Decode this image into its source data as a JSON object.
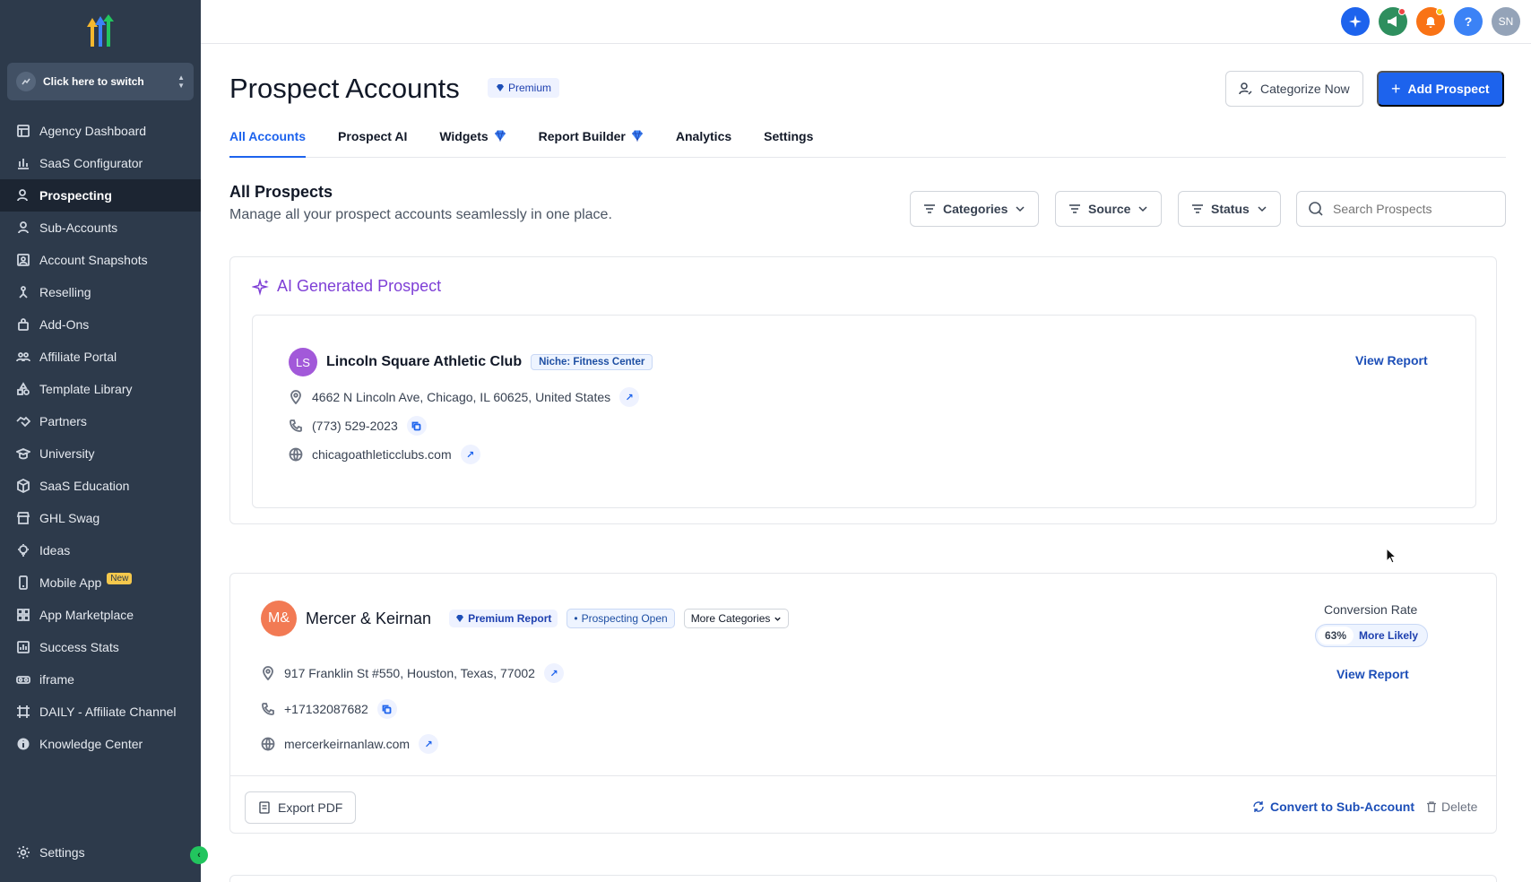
{
  "sidebar": {
    "switcher_label": "Click here to switch",
    "items": [
      {
        "label": "Agency Dashboard",
        "icon": "dashboard-icon"
      },
      {
        "label": "SaaS Configurator",
        "icon": "chart-bars-icon"
      },
      {
        "label": "Prospecting",
        "icon": "user-search-icon",
        "active": true
      },
      {
        "label": "Sub-Accounts",
        "icon": "user-icon"
      },
      {
        "label": "Account Snapshots",
        "icon": "snapshot-icon"
      },
      {
        "label": "Reselling",
        "icon": "reselling-icon"
      },
      {
        "label": "Add-Ons",
        "icon": "bag-icon"
      },
      {
        "label": "Affiliate Portal",
        "icon": "users-icon"
      },
      {
        "label": "Template Library",
        "icon": "shapes-icon"
      },
      {
        "label": "Partners",
        "icon": "handshake-icon"
      },
      {
        "label": "University",
        "icon": "graduation-cap-icon"
      },
      {
        "label": "SaaS Education",
        "icon": "box-icon"
      },
      {
        "label": "GHL Swag",
        "icon": "store-icon"
      },
      {
        "label": "Ideas",
        "icon": "lightbulb-icon"
      },
      {
        "label": "Mobile App",
        "icon": "phone-icon",
        "badge": "New"
      },
      {
        "label": "App Marketplace",
        "icon": "grid-icon"
      },
      {
        "label": "Success Stats",
        "icon": "stats-icon"
      },
      {
        "label": "iframe",
        "icon": "vr-icon"
      },
      {
        "label": "DAILY - Affiliate Channel",
        "icon": "frame-icon"
      },
      {
        "label": "Knowledge Center",
        "icon": "info-icon"
      }
    ],
    "settings_label": "Settings"
  },
  "topbar": {
    "avatar_initials": "SN",
    "help_glyph": "?"
  },
  "header": {
    "title": "Prospect Accounts",
    "premium_label": "Premium",
    "categorize_label": "Categorize Now",
    "add_label": "Add Prospect"
  },
  "tabs": [
    {
      "label": "All Accounts",
      "active": true
    },
    {
      "label": "Prospect AI"
    },
    {
      "label": "Widgets",
      "gem": true
    },
    {
      "label": "Report Builder",
      "gem": true
    },
    {
      "label": "Analytics"
    },
    {
      "label": "Settings"
    }
  ],
  "section": {
    "title": "All Prospects",
    "subtitle": "Manage all your prospect accounts seamlessly in one place.",
    "filters": [
      "Categories",
      "Source",
      "Status"
    ],
    "search_placeholder": "Search Prospects"
  },
  "ai_card": {
    "title": "AI Generated Prospect",
    "prospect": {
      "initials": "LS",
      "name": "Lincoln Square Athletic Club",
      "niche": "Niche: Fitness Center",
      "address": "4662 N Lincoln Ave, Chicago, IL 60625, United States",
      "phone": "(773) 529-2023",
      "website": "chicagoathleticclubs.com",
      "view_report": "View Report"
    }
  },
  "card2": {
    "initials": "M&",
    "name": "Mercer & Keirnan",
    "premium_report": "Premium Report",
    "status": "Prospecting Open",
    "more_categories": "More Categories",
    "conversion_label": "Conversion Rate",
    "conversion_pct": "63%",
    "conversion_text": "More Likely",
    "address": "917 Franklin St #550, Houston, Texas, 77002",
    "phone": "+17132087682",
    "website": "mercerkeirnanlaw.com",
    "view_report": "View Report",
    "export_label": "Export PDF",
    "convert_label": "Convert to Sub-Account",
    "delete_label": "Delete"
  },
  "colors": {
    "sidebar_bg": "#2d3a4b",
    "primary": "#1d63ed",
    "ai_purple": "#7e3fd6",
    "avatar_purple": "#a259d9",
    "avatar_orange": "#f27a54"
  }
}
